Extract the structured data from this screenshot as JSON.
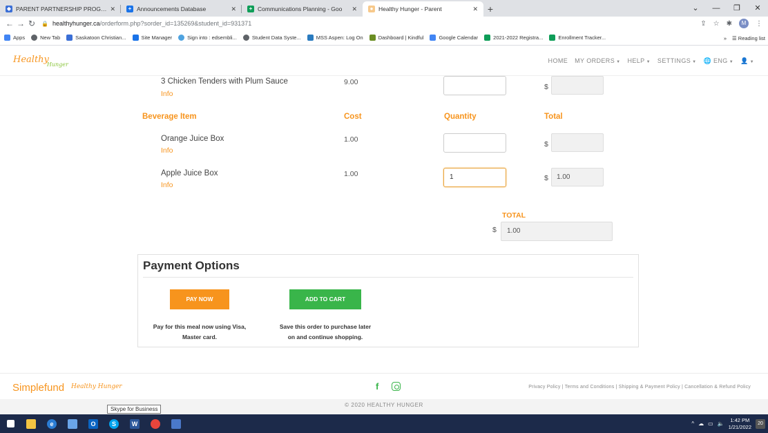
{
  "browser": {
    "tabs": [
      {
        "label": "PARENT PARTNERSHIP PROGRAM",
        "color": "#3b6fd6",
        "active": false
      },
      {
        "label": "Announcements Database",
        "color": "#1a73e8",
        "active": false
      },
      {
        "label": "Communications Planning - Goo",
        "color": "#0f9d58",
        "active": false
      },
      {
        "label": "Healthy Hunger - Parent",
        "color": "#f7941d",
        "active": true
      }
    ],
    "url_host": "healthyhunger.ca",
    "url_path": "/orderform.php?sorder_id=135269&student_id=931371",
    "profile_initial": "M",
    "bookmarks": [
      {
        "label": "Apps",
        "color": "#4285f4"
      },
      {
        "label": "New Tab",
        "color": "#5f6368"
      },
      {
        "label": "Saskatoon Christian...",
        "color": "#3b6fd6"
      },
      {
        "label": "Site Manager",
        "color": "#1a73e8"
      },
      {
        "label": "Sign into : edsembli...",
        "color": "#4fa3e0"
      },
      {
        "label": "Student Data Syste...",
        "color": "#5f6368"
      },
      {
        "label": "MSS Aspen: Log On",
        "color": "#2a7bbf"
      },
      {
        "label": "Dashboard | Kindful",
        "color": "#6b8e23"
      },
      {
        "label": "Google Calendar",
        "color": "#4285f4"
      },
      {
        "label": "2021-2022 Registra...",
        "color": "#0f9d58"
      },
      {
        "label": "Enrollment Tracker...",
        "color": "#0f9d58"
      }
    ],
    "reading_list": "Reading list"
  },
  "site": {
    "logo_main": "Healthy",
    "logo_sub": "Hunger",
    "nav": {
      "home": "HOME",
      "my_orders": "MY ORDERS",
      "help": "HELP",
      "settings": "SETTINGS",
      "lang": "ENG"
    }
  },
  "order": {
    "top_item": {
      "name": "3 Chicken Tenders with Plum Sauce",
      "info": "Info",
      "cost": "9.00",
      "quantity": "",
      "total": ""
    },
    "beverage_header": {
      "item": "Beverage Item",
      "cost": "Cost",
      "quantity": "Quantity",
      "total": "Total"
    },
    "beverages": [
      {
        "name": "Orange Juice Box",
        "info": "Info",
        "cost": "1.00",
        "quantity": "",
        "total": ""
      },
      {
        "name": "Apple Juice Box",
        "info": "Info",
        "cost": "1.00",
        "quantity": "1",
        "total": "1.00"
      }
    ],
    "currency": "$",
    "grand_total_label": "TOTAL",
    "grand_total": "1.00"
  },
  "payment": {
    "title": "Payment Options",
    "pay_now": "PAY NOW",
    "add_to_cart": "ADD TO CART",
    "pay_now_desc_1": "Pay for this meal now using Visa,",
    "pay_now_desc_2": "Master card.",
    "cart_desc_1": "Save this order to purchase later",
    "cart_desc_2": "on and continue shopping."
  },
  "footer": {
    "simplefund_1": "Simple",
    "simplefund_2": "fund",
    "hh_logo": "Healthy Hunger",
    "links": "Privacy Policy | Terms and Conditions | Shipping & Payment Policy | Cancellation & Refund Policy",
    "copyright": "© 2020 HEALTHY HUNGER"
  },
  "tooltip": "Skype for Business",
  "taskbar": {
    "time": "1:42 PM",
    "date": "1/21/2022",
    "notifications": "20"
  },
  "colors": {
    "brand_orange": "#f7941d",
    "brand_green": "#39b54a"
  }
}
